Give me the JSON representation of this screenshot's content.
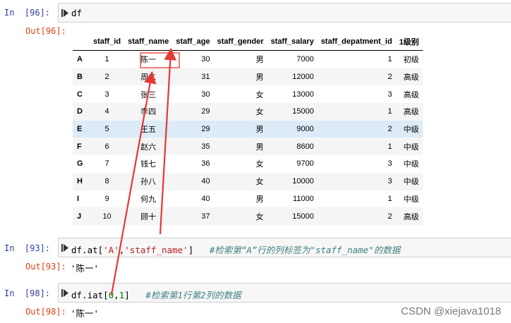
{
  "cells": [
    {
      "in_label": "In  [96]:",
      "code_text": "df",
      "out_label": "Out[96]:"
    },
    {
      "in_label": "In  [93]:",
      "code_prefix": "df.at[",
      "code_arg1": "'A'",
      "code_sep": ",",
      "code_arg2": "'staff_name'",
      "code_suffix": "]",
      "code_comment": "#检索第“A”行的列标签为\"staff_name\"的数据",
      "out_label": "Out[93]:",
      "out_value": "'陈一'"
    },
    {
      "in_label": "In  [98]:",
      "code_prefix": "df.iat[",
      "code_arg1": "0",
      "code_sep": ",",
      "code_arg2": "1",
      "code_suffix": "]",
      "code_comment": "#检索第1行第2列的数据",
      "out_label": "Out[98]:",
      "out_value": "'陈一'"
    }
  ],
  "dataframe": {
    "columns": [
      "staff_id",
      "staff_name",
      "staff_age",
      "staff_gender",
      "staff_salary",
      "staff_depatment_id",
      "1级别"
    ],
    "rows": [
      {
        "index": "A",
        "values": [
          "1",
          "陈一",
          "30",
          "男",
          "7000",
          "1",
          "初级"
        ]
      },
      {
        "index": "B",
        "values": [
          "2",
          "周二",
          "31",
          "男",
          "12000",
          "2",
          "高级"
        ]
      },
      {
        "index": "C",
        "values": [
          "3",
          "张三",
          "30",
          "女",
          "13000",
          "3",
          "高级"
        ]
      },
      {
        "index": "D",
        "values": [
          "4",
          "李四",
          "29",
          "女",
          "15000",
          "1",
          "高级"
        ]
      },
      {
        "index": "E",
        "values": [
          "5",
          "王五",
          "29",
          "男",
          "9000",
          "2",
          "中级"
        ]
      },
      {
        "index": "F",
        "values": [
          "6",
          "赵六",
          "35",
          "男",
          "8600",
          "1",
          "中级"
        ]
      },
      {
        "index": "G",
        "values": [
          "7",
          "钱七",
          "36",
          "女",
          "9700",
          "3",
          "中级"
        ]
      },
      {
        "index": "H",
        "values": [
          "8",
          "孙八",
          "40",
          "女",
          "10000",
          "3",
          "中级"
        ]
      },
      {
        "index": "I",
        "values": [
          "9",
          "何九",
          "40",
          "男",
          "11000",
          "1",
          "中级"
        ]
      },
      {
        "index": "J",
        "values": [
          "10",
          "顾十",
          "37",
          "女",
          "15000",
          "2",
          "高级"
        ]
      }
    ],
    "highlighted_row": "E"
  },
  "colors": {
    "annotation": "#e53935",
    "prompt_in": "#303f9f",
    "prompt_out": "#d84315"
  },
  "watermark": "CSDN @xiejava1018"
}
